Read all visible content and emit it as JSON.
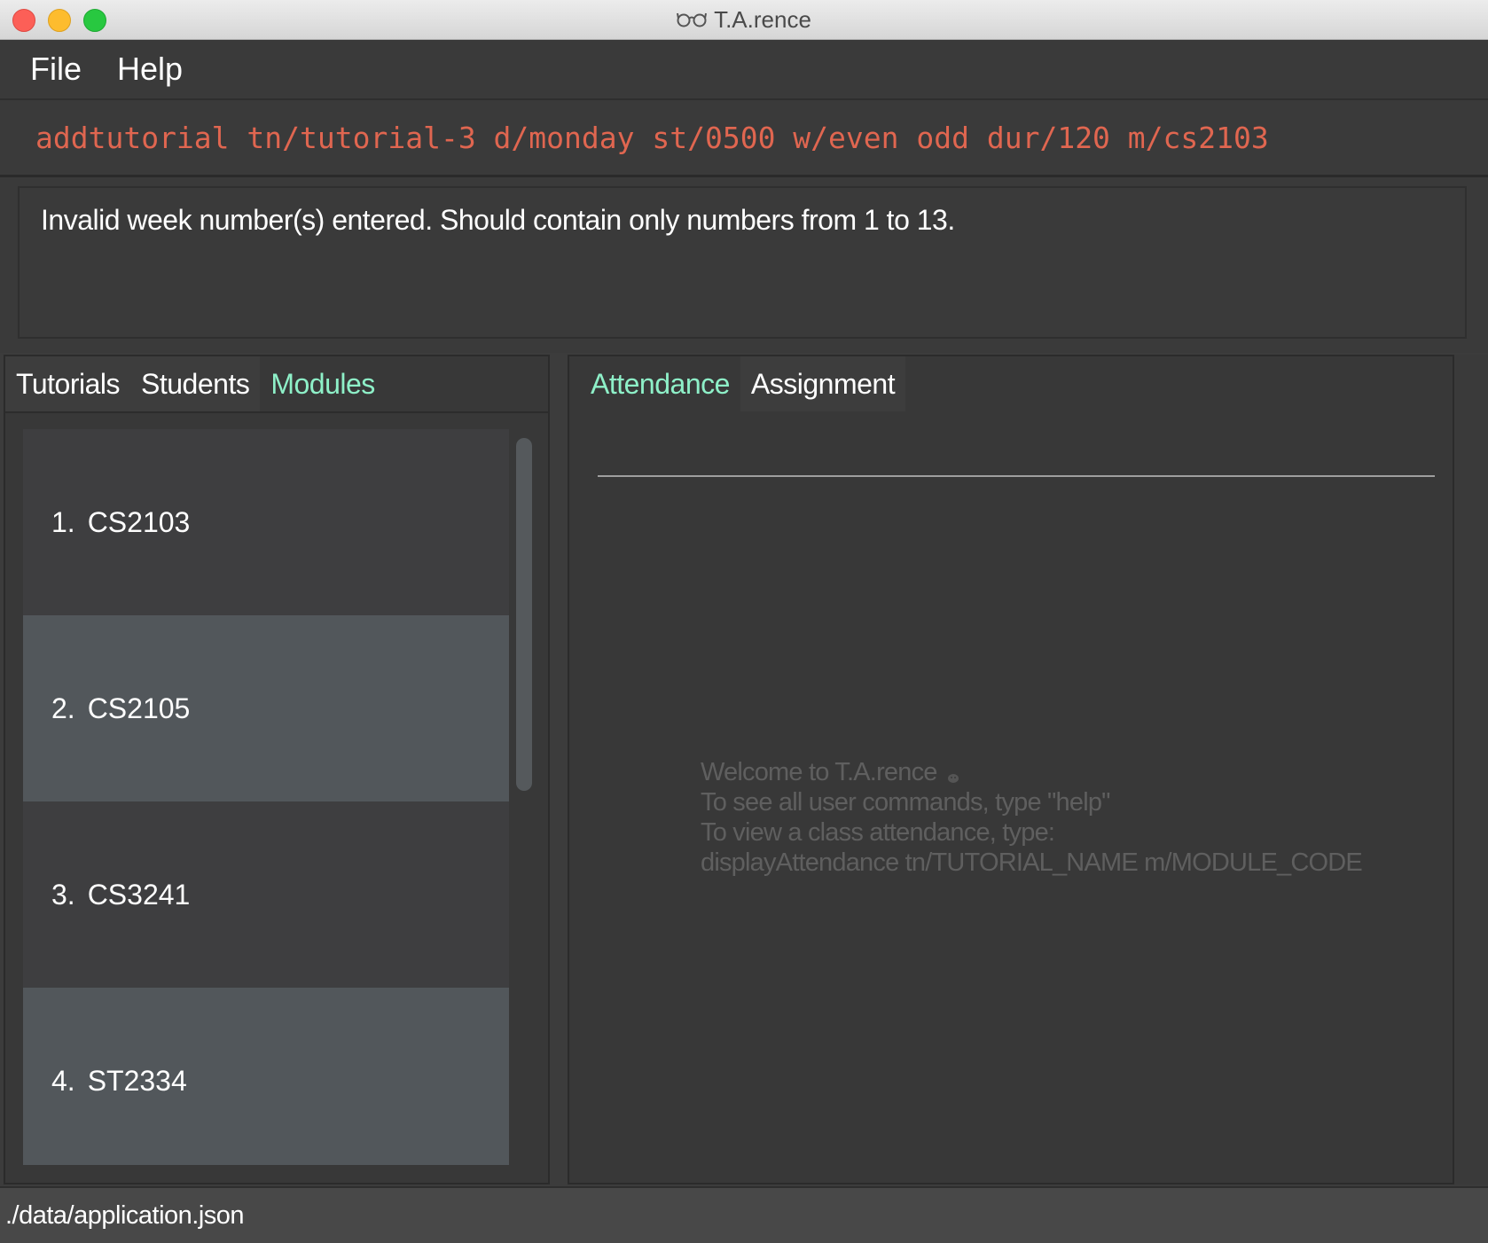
{
  "window": {
    "title": "T.A.rence",
    "icon": "glasses-icon"
  },
  "menu": {
    "items": [
      "File",
      "Help"
    ]
  },
  "command": {
    "value": "addtutorial tn/tutorial-3 d/monday st/0500 w/even odd dur/120 m/cs2103"
  },
  "result": {
    "message": "Invalid week number(s) entered. Should contain only numbers from 1 to 13."
  },
  "left_panel": {
    "tabs": [
      {
        "label": "Tutorials",
        "active": false
      },
      {
        "label": "Students",
        "active": false
      },
      {
        "label": "Modules",
        "active": true
      }
    ],
    "items": [
      {
        "index": "1.",
        "code": "CS2103"
      },
      {
        "index": "2.",
        "code": "CS2105"
      },
      {
        "index": "3.",
        "code": "CS3241"
      },
      {
        "index": "4.",
        "code": "ST2334"
      }
    ]
  },
  "right_panel": {
    "tabs": [
      {
        "label": "Attendance",
        "active": true
      },
      {
        "label": "Assignment",
        "active": false
      }
    ],
    "welcome": {
      "line1": "Welcome to T.A.rence",
      "line2": "To see all user commands, type \"help\"",
      "line3": "To view a class attendance, type:",
      "line4": "displayAttendance tn/TUTORIAL_NAME m/MODULE_CODE"
    }
  },
  "status": {
    "path": "./data/application.json"
  },
  "colors": {
    "accent_tab": "#8ef0c8",
    "command_text": "#e06650",
    "background": "#3a3a3a"
  }
}
